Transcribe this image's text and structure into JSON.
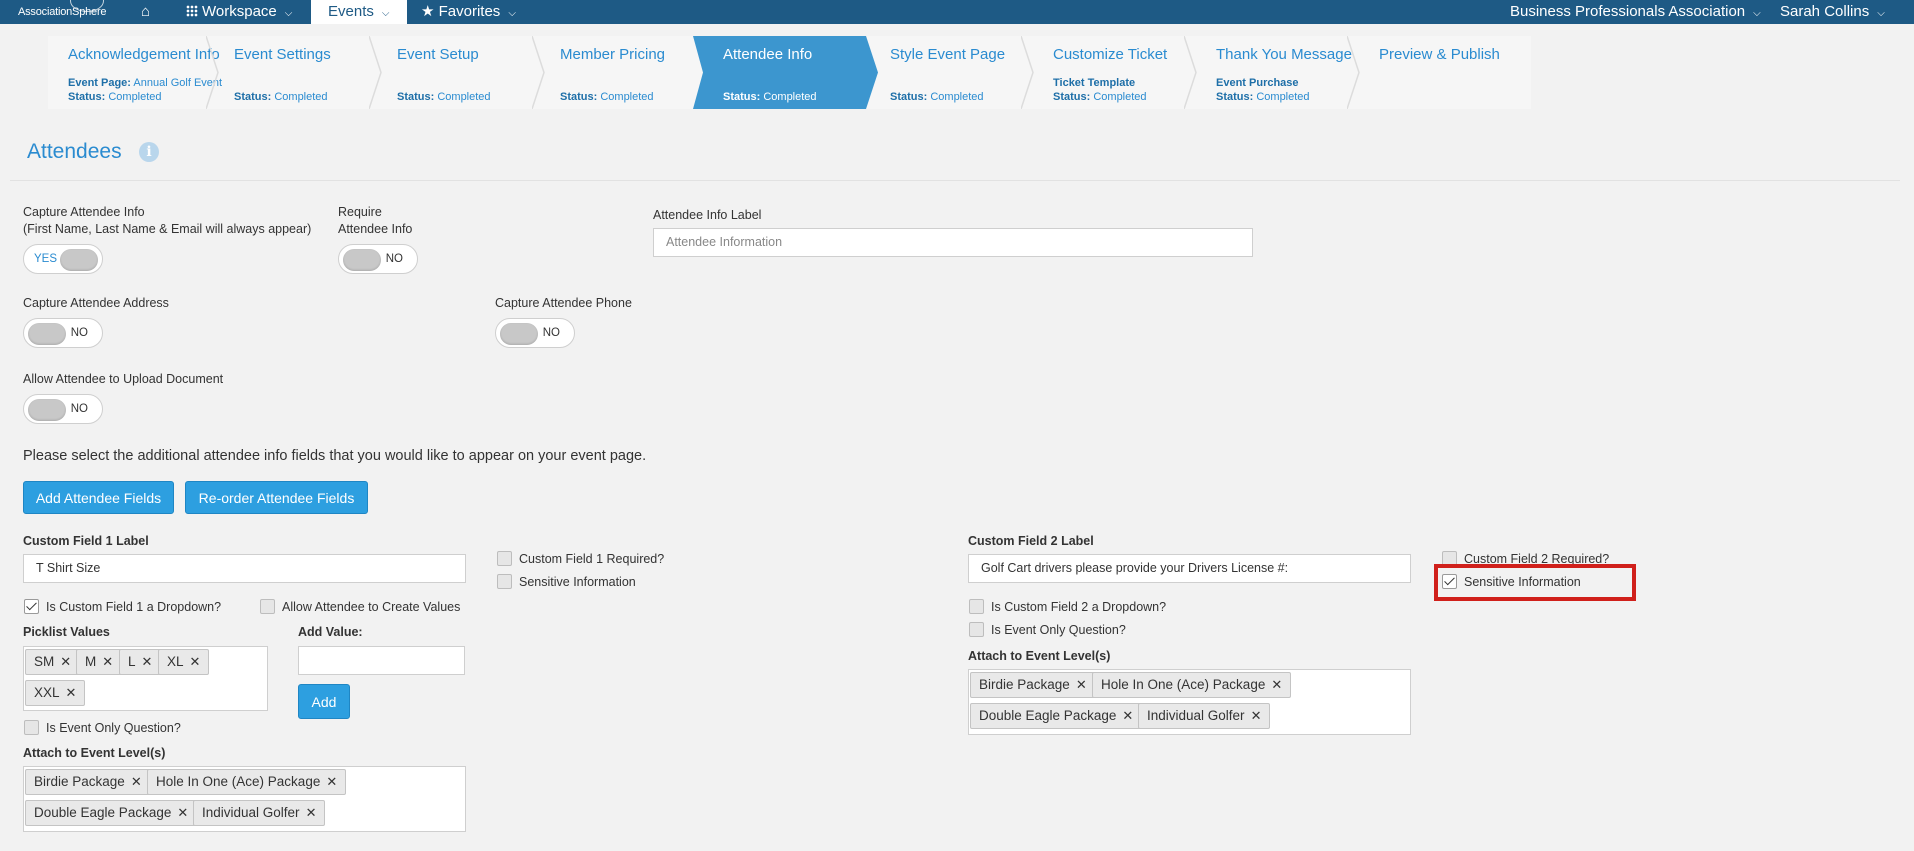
{
  "topbar": {
    "logo": "AssociationSphere",
    "nav": {
      "workspace": "Workspace",
      "events": "Events",
      "favorites": "Favorites"
    },
    "organization": "Business Professionals Association",
    "user": "Sarah Collins"
  },
  "steps": [
    {
      "title": "Acknowledgement Info",
      "sub1_key": "Event Page:",
      "sub1_val": "Annual Golf Event",
      "status_key": "Status:",
      "status_val": "Completed"
    },
    {
      "title": "Event Settings",
      "status_key": "Status:",
      "status_val": "Completed"
    },
    {
      "title": "Event Setup",
      "status_key": "Status:",
      "status_val": "Completed"
    },
    {
      "title": "Member Pricing",
      "status_key": "Status:",
      "status_val": "Completed"
    },
    {
      "title": "Attendee Info",
      "status_key": "Status:",
      "status_val": "Completed"
    },
    {
      "title": "Style Event Page",
      "status_key": "Status:",
      "status_val": "Completed"
    },
    {
      "title": "Customize Ticket",
      "sub1_key": "Ticket Template",
      "status_key": "Status:",
      "status_val": "Completed"
    },
    {
      "title": "Thank You Message",
      "sub1_key": "Event Purchase",
      "status_key": "Status:",
      "status_val": "Completed"
    },
    {
      "title": "Preview & Publish"
    }
  ],
  "page": {
    "title": "Attendees",
    "info_glyph": "i"
  },
  "form": {
    "capture_info_label1": "Capture Attendee Info",
    "capture_info_label2": "(First Name, Last Name & Email will always appear)",
    "capture_info_value": "YES",
    "require_label1": "Require",
    "require_label2": "Attendee Info",
    "require_value": "NO",
    "info_label_label": "Attendee Info Label",
    "info_label_placeholder": "Attendee Information",
    "address_label": "Capture Attendee Address",
    "address_value": "NO",
    "phone_label": "Capture Attendee Phone",
    "phone_value": "NO",
    "upload_label": "Allow Attendee to Upload Document",
    "upload_value": "NO",
    "instruction": "Please select the additional attendee info fields that you would like to appear on your event page.",
    "add_fields_btn": "Add Attendee Fields",
    "reorder_btn": "Re-order Attendee Fields"
  },
  "cf1": {
    "label": "Custom Field 1 Label",
    "value": "T Shirt Size",
    "required": "Custom Field 1 Required?",
    "sensitive": "Sensitive Information",
    "dropdown": "Is Custom Field 1 a Dropdown?",
    "allow_create": "Allow Attendee to Create Values",
    "picklist_label": "Picklist Values",
    "picklist": [
      "SM",
      "M",
      "L",
      "XL",
      "XXL"
    ],
    "add_value_label": "Add Value:",
    "add_btn": "Add",
    "event_only": "Is Event Only Question?",
    "attach_label": "Attach to Event Level(s)",
    "levels": [
      "Birdie Package",
      "Hole In One (Ace) Package",
      "Double Eagle Package",
      "Individual Golfer"
    ]
  },
  "cf2": {
    "label": "Custom Field 2 Label",
    "value": "Golf Cart drivers please provide your Drivers License #:",
    "required": "Custom Field 2 Required?",
    "sensitive": "Sensitive Information",
    "dropdown": "Is Custom Field 2 a Dropdown?",
    "event_only": "Is Event Only Question?",
    "attach_label": "Attach to Event Level(s)",
    "levels": [
      "Birdie Package",
      "Hole In One (Ace) Package",
      "Double Eagle Package",
      "Individual Golfer"
    ]
  },
  "tag_remove_glyph": "✕",
  "colors": {
    "topbar": "#1e5a85",
    "accent": "#2a8bd0",
    "active_step": "#3c96cf",
    "button": "#2d9fe0",
    "highlight": "#d0201b"
  }
}
